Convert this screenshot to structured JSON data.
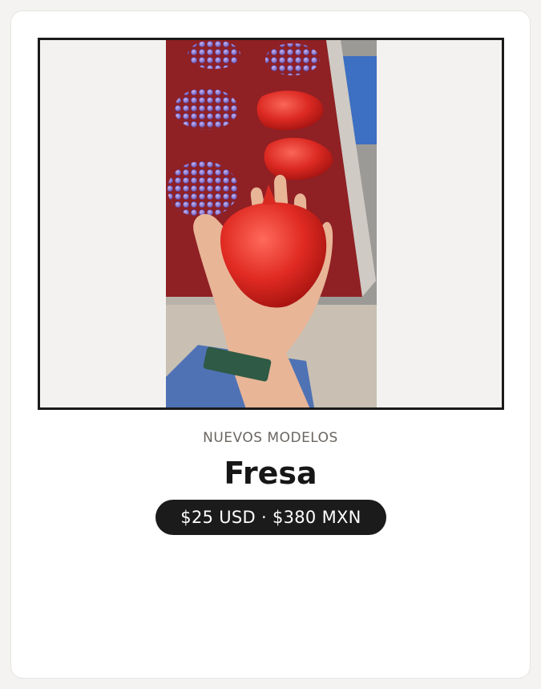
{
  "product": {
    "eyebrow": "NUEVOS MODELOS",
    "name": "Fresa",
    "price": "$25 USD · $380 MXN",
    "image_alt": "Resin fruit molds: purple grape shapes and red strawberry shapes on a red tray, one red strawberry held in a hand"
  },
  "colors": {
    "card": "#ffffff",
    "background": "#f4f3f2",
    "frame_border": "#1a1a1a",
    "pill_background": "#1b1b1b",
    "pill_text": "#ffffff",
    "eyebrow_text": "#6b6560",
    "title_text": "#161616"
  }
}
